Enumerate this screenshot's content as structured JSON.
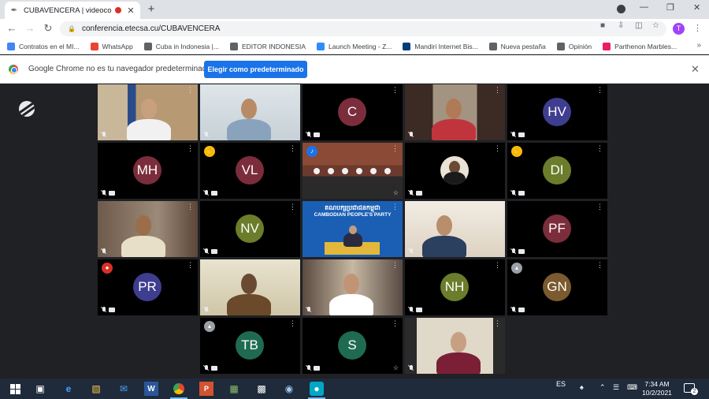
{
  "browser": {
    "tab": {
      "title": "CUBAVENCERA | videoconfe"
    },
    "url": "conferencia.etecsa.cu/CUBAVENCERA",
    "profile_initial": "T",
    "bookmarks": [
      {
        "label": "Contratos en el MI...",
        "color": "#4285f4",
        "icon": "globe-icon"
      },
      {
        "label": "WhatsApp",
        "color": "#ea4335",
        "icon": "whatsapp-icon"
      },
      {
        "label": "Cuba in Indonesia |...",
        "color": "#5f6368",
        "icon": "emblem-icon"
      },
      {
        "label": "EDITOR INDONESIA",
        "color": "#5f6368",
        "icon": "emblem-icon"
      },
      {
        "label": "Launch Meeting - Z...",
        "color": "#2d8cff",
        "icon": "zoom-icon"
      },
      {
        "label": "Mandiri Internet Bis...",
        "color": "#003d79",
        "icon": "bank-icon"
      },
      {
        "label": "Nueva pestaña",
        "color": "#5f6368",
        "icon": "globe-icon"
      },
      {
        "label": "Opinión",
        "color": "#5f6368",
        "icon": "globe-icon"
      },
      {
        "label": "Parthenon Marbles...",
        "color": "#e91e63",
        "icon": "image-icon"
      }
    ],
    "infobar": {
      "message": "Google Chrome no es tu navegador predeterminado",
      "button": "Elegir como predeterminado"
    }
  },
  "meeting": {
    "tiles": [
      {
        "id": "p1",
        "type": "video",
        "muted": true,
        "cam_off": false
      },
      {
        "id": "p2",
        "type": "video",
        "muted": true,
        "cam_off": false
      },
      {
        "id": "p3",
        "type": "initials",
        "initials": "C",
        "color": "#7b2d3b",
        "muted": true,
        "cam_off": true
      },
      {
        "id": "p4",
        "type": "video",
        "muted": true,
        "cam_off": false
      },
      {
        "id": "p5",
        "type": "initials",
        "initials": "HV",
        "color": "#3f3d8f",
        "muted": true,
        "cam_off": true
      },
      {
        "id": "p6",
        "type": "initials",
        "initials": "MH",
        "color": "#7b2d3b",
        "muted": true,
        "cam_off": true
      },
      {
        "id": "p7",
        "type": "initials",
        "initials": "VL",
        "color": "#7b2d3b",
        "muted": true,
        "cam_off": true,
        "badge": "hand"
      },
      {
        "id": "p8",
        "type": "video",
        "muted": false,
        "cam_off": false,
        "active": true,
        "badge": "speaking"
      },
      {
        "id": "p9",
        "type": "video",
        "muted": true,
        "cam_off": true
      },
      {
        "id": "p10",
        "type": "initials",
        "initials": "DI",
        "color": "#6b7d2a",
        "muted": true,
        "cam_off": true,
        "badge": "hand"
      },
      {
        "id": "p11",
        "type": "video",
        "muted": true,
        "cam_off": false
      },
      {
        "id": "p12",
        "type": "initials",
        "initials": "NV",
        "color": "#6b7d2a",
        "muted": true,
        "cam_off": true
      },
      {
        "id": "p13",
        "type": "party",
        "muted": false,
        "cam_off": false
      },
      {
        "id": "p14",
        "type": "video",
        "muted": true,
        "cam_off": false
      },
      {
        "id": "p15",
        "type": "initials",
        "initials": "PF",
        "color": "#7b2d3b",
        "muted": true,
        "cam_off": true
      },
      {
        "id": "p16",
        "type": "initials",
        "initials": "PR",
        "color": "#3f3d8f",
        "muted": true,
        "cam_off": true,
        "badge": "record"
      },
      {
        "id": "p17",
        "type": "video",
        "muted": true,
        "cam_off": false
      },
      {
        "id": "p18",
        "type": "video",
        "muted": true,
        "cam_off": false
      },
      {
        "id": "p19",
        "type": "initials",
        "initials": "NH",
        "color": "#6b7d2a",
        "muted": true,
        "cam_off": true
      },
      {
        "id": "p20",
        "type": "initials",
        "initials": "GN",
        "color": "#7a5a2e",
        "muted": true,
        "cam_off": true,
        "badge": "signal"
      },
      {
        "id": "p21",
        "type": "initials",
        "initials": "TB",
        "color": "#1f6b52",
        "muted": true,
        "cam_off": true,
        "badge": "signal"
      },
      {
        "id": "p22",
        "type": "initials",
        "initials": "S",
        "color": "#1f6b52",
        "muted": true,
        "cam_off": true
      },
      {
        "id": "p23",
        "type": "video",
        "muted": true,
        "cam_off": false
      }
    ],
    "party_banner": {
      "khmer": "គណបក្សប្រជាជនកម្ពុជា",
      "english": "CAMBODIAN PEOPLE'S PARTY"
    }
  },
  "taskbar": {
    "language": "ES",
    "time": "7:34 AM",
    "date": "10/2/2021",
    "notifications": "2"
  }
}
